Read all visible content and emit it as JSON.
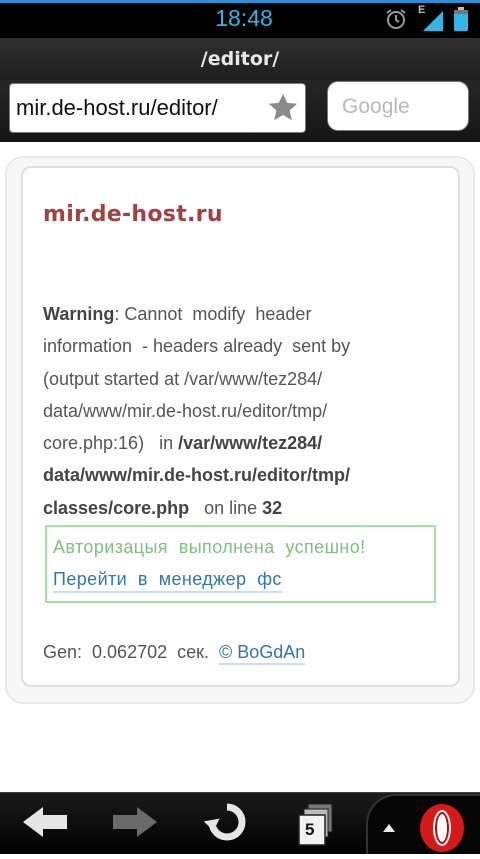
{
  "status_bar": {
    "time": "18:48",
    "network_label": "E",
    "icons": [
      "alarm-icon",
      "signal-icon",
      "battery-icon"
    ],
    "accent_color": "#33b5e5"
  },
  "browser": {
    "page_title": "/editor/",
    "url": "mir.de-host.ru/editor/",
    "search_placeholder": "Google"
  },
  "content": {
    "site_name": "mir.de-host.ru",
    "warning": {
      "label": "Warning",
      "line1_rest": ": Cannot  modify  header",
      "line2": "information  - headers already  sent by",
      "line3": "(output started at /var/www/tez284/",
      "line4": "data/www/mir.de-host.ru/editor/tmp/",
      "line5_pre": "core.php:16)   in ",
      "line5_bold": "/var/www/tez284/",
      "line6_bold": "data/www/mir.de-host.ru/editor/tmp/",
      "line7_bold": "classes/core.php",
      "line7_mid": "   on line ",
      "line7_num": "32"
    },
    "success_message": "Авторизацыя  выполнена  успешно!",
    "manager_link": "Перейти  в  менеджер  фс",
    "gen_label": "Gen:",
    "gen_value": "0.062702",
    "gen_unit": "сек.",
    "author_link": "© BoGdAn",
    "colors": {
      "site_name": "#a83f3f",
      "success": "#80c080",
      "link": "#2f76b3",
      "success_border": "#9fe59f"
    }
  },
  "toolbar": {
    "tab_count": "5",
    "icons": [
      "back-arrow-icon",
      "forward-arrow-icon",
      "reload-icon",
      "tabs-icon",
      "menu-up-icon",
      "opera-logo-icon"
    ]
  }
}
